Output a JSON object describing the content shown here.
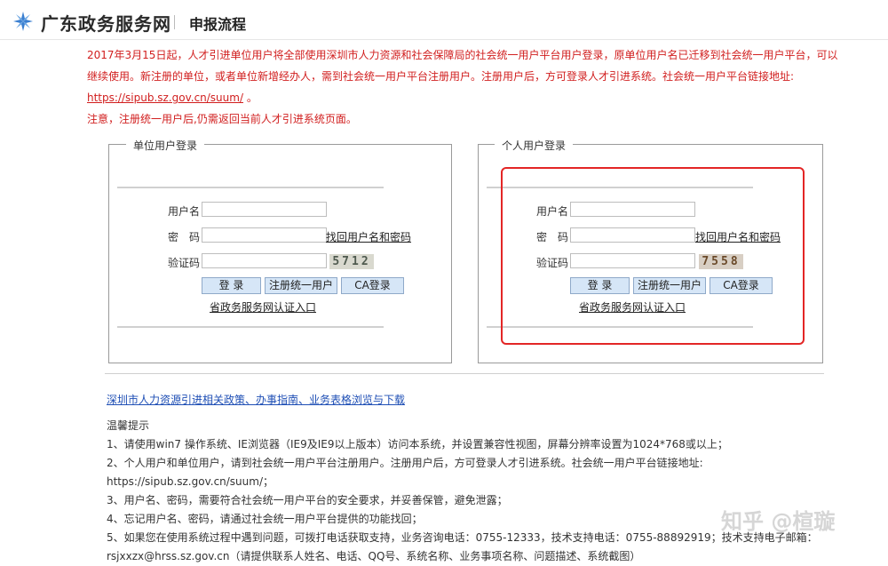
{
  "header": {
    "site_name": "广东政务服务网",
    "nav_title": "申报流程"
  },
  "notice": {
    "line1": "2017年3月15日起，人才引进单位用户将全部使用深圳市人力资源和社会保障局的社会统一用户平台用户登录，原单位用户名已迁移到社会统一用户平台，可以继续使用。新注册的单位，或者单位新增经办人，需到社会统一用户平台注册用户。注册用户后，方可登录人才引进系统。社会统一用户平台链接地址:",
    "link": "https://sipub.sz.gov.cn/suum/",
    "link_suffix": "。",
    "line2": "注意，注册统一用户后,仍需返回当前人才引进系统页面。"
  },
  "unit_login": {
    "legend": "单位用户登录",
    "username_label": "用户名",
    "password_label": "密　码",
    "recover_link": "找回用户名和密码",
    "captcha_label": "验证码",
    "captcha": "5712",
    "login_btn": "登 录",
    "register_btn": "注册统一用户",
    "ca_btn": "CA登录",
    "gov_link": "省政务服务网认证入口"
  },
  "personal_login": {
    "legend": "个人用户登录",
    "username_label": "用户名",
    "password_label": "密　码",
    "recover_link": "找回用户名和密码",
    "captcha_label": "验证码",
    "captcha": "7558",
    "login_btn": "登 录",
    "register_btn": "注册统一用户",
    "ca_btn": "CA登录",
    "gov_link": "省政务服务网认证入口"
  },
  "policy_link": "深圳市人力资源引进相关政策、办事指南、业务表格浏览与下载",
  "tips": {
    "title": "温馨提示",
    "items": [
      "1、请使用win7 操作系统、IE浏览器（IE9及IE9以上版本）访问本系统，并设置兼容性视图，屏幕分辨率设置为1024*768或以上；",
      "2、个人用户和单位用户，请到社会统一用户平台注册用户。注册用户后，方可登录人才引进系统。社会统一用户平台链接地址:",
      "https://sipub.sz.gov.cn/suum/；",
      "3、用户名、密码，需要符合社会统一用户平台的安全要求，并妥善保管，避免泄露；",
      "4、忘记用户名、密码，请通过社会统一用户平台提供的功能找回；",
      "5、如果您在使用系统过程中遇到问题，可拨打电话获取支持，业务咨询电话：0755-12333，技术支持电话：0755-88892919；技术支持电子邮箱：",
      "rsjxxzx@hrss.sz.gov.cn（请提供联系人姓名、电话、QQ号、系统名称、业务事项名称、问题描述、系统截图）"
    ]
  },
  "watermark": "知乎 @楦璇",
  "colors": {
    "notice_red": "#d11e1e",
    "link_blue": "#1f4fb5",
    "highlight": "#e32626",
    "button_bg": "#d6e6f7"
  },
  "icons": {
    "logo": "gd-gov-logo-icon"
  }
}
